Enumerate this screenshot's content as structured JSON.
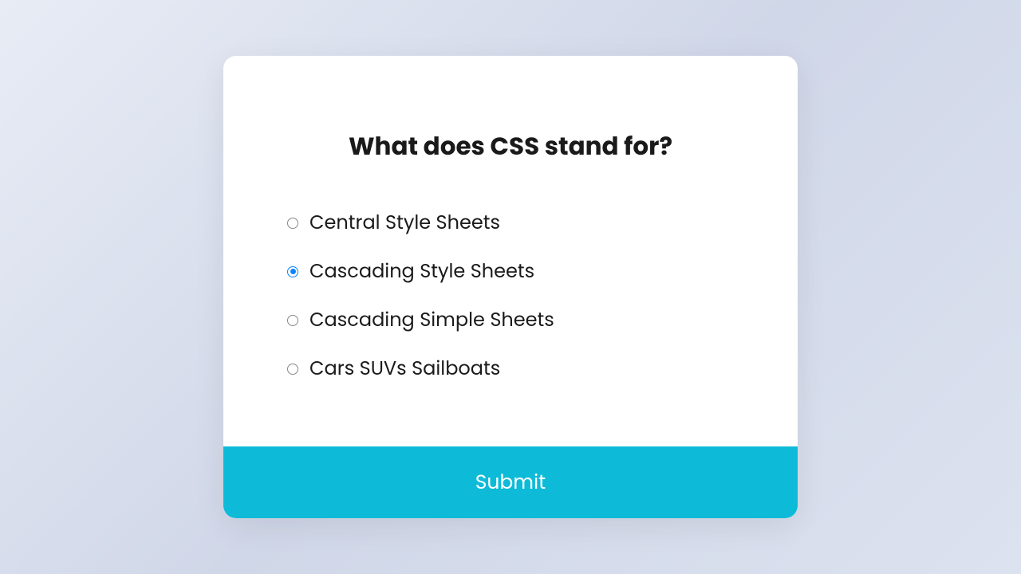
{
  "quiz": {
    "question": "What does CSS stand for?",
    "options": [
      {
        "label": "Central Style Sheets",
        "selected": false
      },
      {
        "label": "Cascading Style Sheets",
        "selected": true
      },
      {
        "label": "Cascading Simple Sheets",
        "selected": false
      },
      {
        "label": "Cars SUVs Sailboats",
        "selected": false
      }
    ],
    "submit_label": "Submit"
  },
  "colors": {
    "accent": "#0dbbd9",
    "radio_selected": "#0a84ff"
  }
}
